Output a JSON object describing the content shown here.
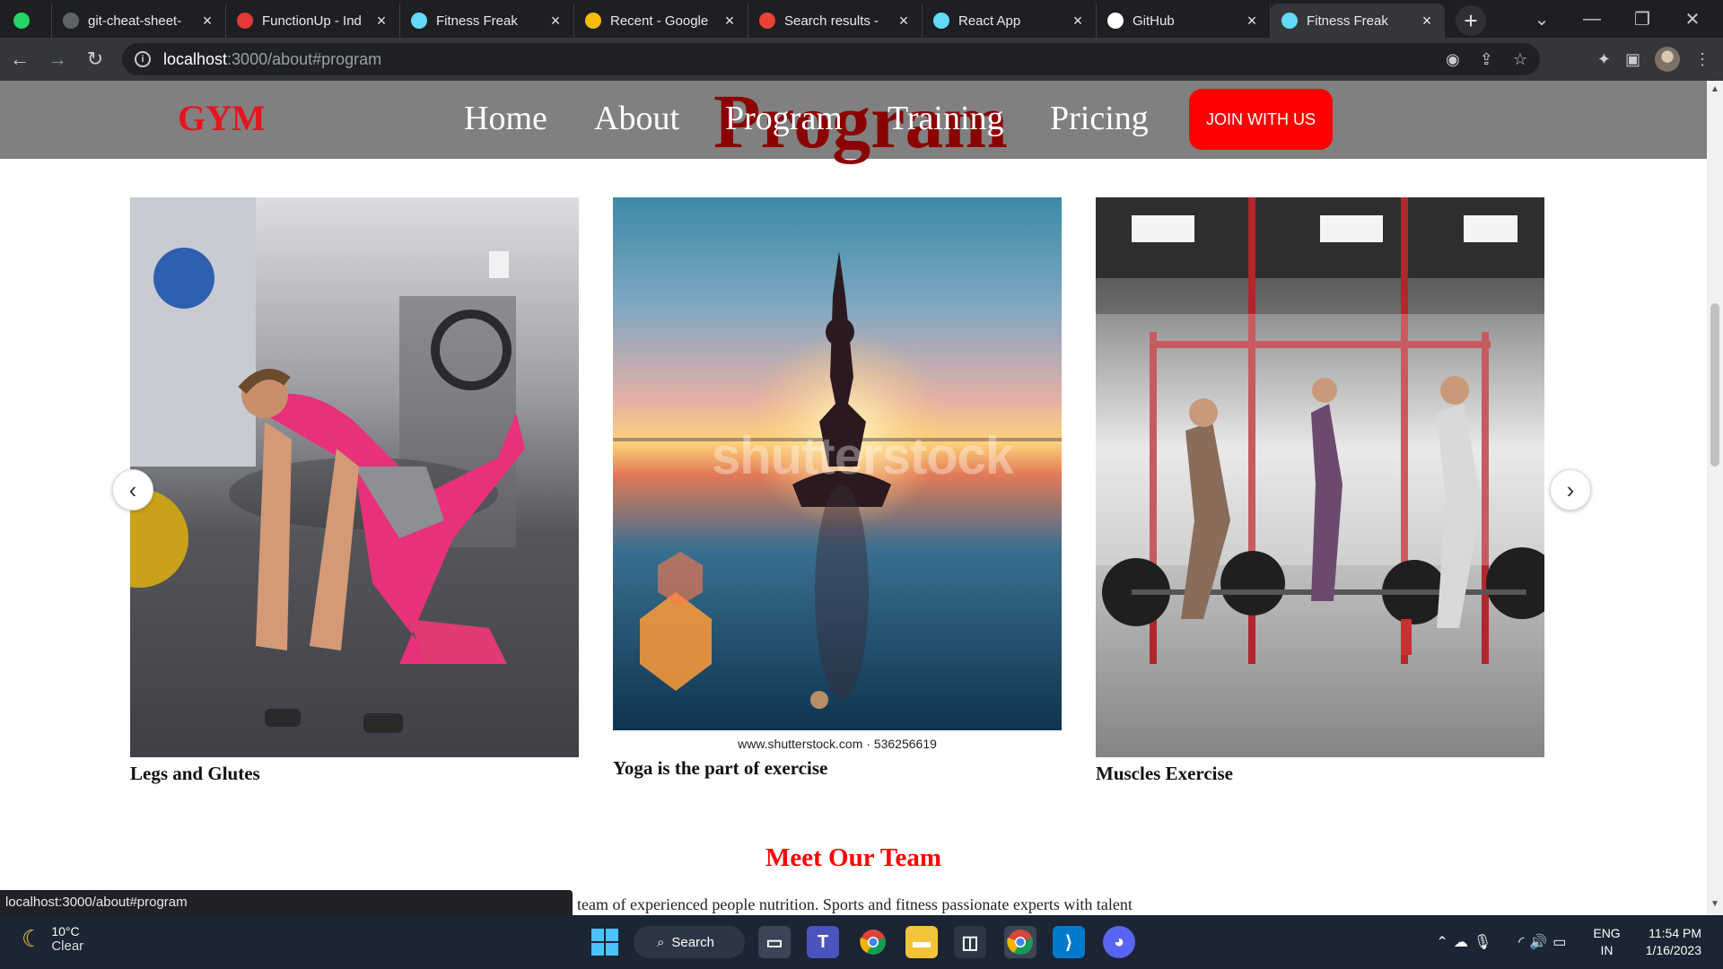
{
  "browser": {
    "tabs": [
      {
        "title": "",
        "favicon": "whatsapp-icon",
        "color": "#25d366",
        "active": false
      },
      {
        "title": "git-cheat-sheet-",
        "favicon": "globe-icon",
        "color": "#5f6368",
        "active": false
      },
      {
        "title": "FunctionUp - Ind",
        "favicon": "functionup-icon",
        "color": "#e53935",
        "active": false
      },
      {
        "title": "Fitness Freak",
        "favicon": "react-icon",
        "color": "#61dafb",
        "active": false
      },
      {
        "title": "Recent - Google",
        "favicon": "google-drive-icon",
        "color": "#fbbc04",
        "active": false
      },
      {
        "title": "Search results - ",
        "favicon": "gmail-icon",
        "color": "#ea4335",
        "active": false
      },
      {
        "title": "React App",
        "favicon": "react-icon",
        "color": "#61dafb",
        "active": false
      },
      {
        "title": "GitHub",
        "favicon": "github-icon",
        "color": "#ffffff",
        "active": false
      },
      {
        "title": "Fitness Freak",
        "favicon": "react-icon",
        "color": "#61dafb",
        "active": true
      }
    ],
    "url_host": "localhost",
    "url_rest": ":3000/about#program"
  },
  "site": {
    "brand": "GYM",
    "nav": [
      "Home",
      "About",
      "Program",
      "Training",
      "Pricing"
    ],
    "join_button": "JOIN WITH US",
    "section_heading": "Program",
    "accent_color": "#ff0000",
    "program_cards": [
      {
        "caption": "Legs and Glutes",
        "image": "woman-exercising-in-gym-photo"
      },
      {
        "caption": "Yoga is the part of exercise",
        "image": "yoga-silhouette-sunset-beach-photo",
        "watermark": "shutterstock",
        "credit": "www.shutterstock.com · 536256619"
      },
      {
        "caption": "Muscles Exercise",
        "image": "crossfit-group-barbell-photo"
      }
    ],
    "team_heading": "Meet Our Team",
    "team_text": "team of experienced people nutrition. Sports and fitness passionate experts with talent"
  },
  "status_bar_url": "localhost:3000/about#program",
  "taskbar": {
    "weather_temp": "10°C",
    "weather_desc": "Clear",
    "search_label": "Search",
    "lang_top": "ENG",
    "lang_bottom": "IN",
    "time": "11:54 PM",
    "date": "1/16/2023"
  }
}
